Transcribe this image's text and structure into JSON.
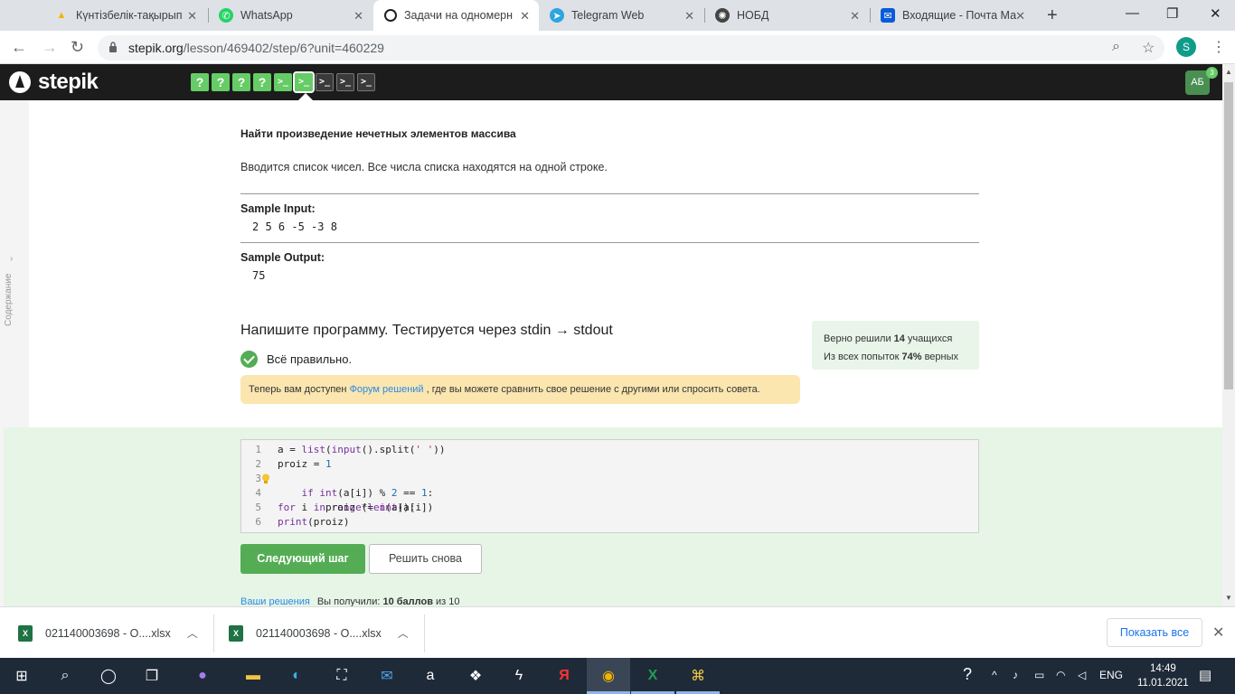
{
  "browser": {
    "tabs": [
      {
        "title": "Күнтізбелік-тақырып",
        "icon": "google-drive-icon",
        "active": false
      },
      {
        "title": "WhatsApp",
        "icon": "whatsapp-icon",
        "active": false
      },
      {
        "title": "Задачи на одномерн",
        "icon": "stepik-icon",
        "active": true
      },
      {
        "title": "Telegram Web",
        "icon": "telegram-icon",
        "active": false
      },
      {
        "title": "НОБД",
        "icon": "nobd-icon",
        "active": false
      },
      {
        "title": "Входящие - Почта Ма",
        "icon": "mail-icon",
        "active": false
      }
    ],
    "url_host": "stepik.org",
    "url_path": "/lesson/469402/step/6?unit=460229",
    "profile_letter": "S"
  },
  "stepik": {
    "logo": "stepik",
    "steps": [
      "?",
      "?",
      "?",
      "?",
      ">_",
      ">_",
      ">_",
      ">_",
      ">_"
    ],
    "avatar": "АБ",
    "avatar_badge": "3"
  },
  "sidebar": {
    "label": "Содержание"
  },
  "problem": {
    "title": "Найти произведение нечетных элементов массива",
    "description": "Вводится список чисел. Все числа списка находятся на одной строке.",
    "sample_input_label": "Sample Input:",
    "sample_input": "2 5 6 -5 -3 8",
    "sample_output_label": "Sample Output:",
    "sample_output": "75"
  },
  "task": {
    "heading": "Напишите программу. Тестируется через stdin → stdout",
    "result": "Всё правильно.",
    "notice_before": "Теперь вам доступен ",
    "notice_link": "Форум решений",
    "notice_after": " , где вы можете сравнить свое решение с другими или спросить совета.",
    "stats_line1_a": "Верно решили ",
    "stats_line1_b": "14",
    "stats_line1_c": " учащихся",
    "stats_line2_a": "Из всех попыток ",
    "stats_line2_b": "74%",
    "stats_line2_c": " верных"
  },
  "code": {
    "lines": [
      "a = list(input().split(' '))",
      "proiz = 1",
      "for i in range(len(a)):",
      "    if int(a[i]) % 2 == 1:",
      "        proiz *= int(a[i])",
      "print(proiz)"
    ],
    "line_numbers": [
      "1",
      "2",
      "3",
      "4",
      "5",
      "6"
    ]
  },
  "actions": {
    "next": "Следующий шаг",
    "retry": "Решить снова",
    "solutions_link": "Ваши решения",
    "score_before": "Вы получили: ",
    "score_bold": "10 баллов",
    "score_after": " из 10"
  },
  "downloads": {
    "items": [
      "021140003698 - О....xlsx",
      "021140003698 - О....xlsx"
    ],
    "show_all": "Показать все"
  },
  "taskbar": {
    "lang": "ENG",
    "time": "14:49",
    "date": "11.01.2021"
  }
}
